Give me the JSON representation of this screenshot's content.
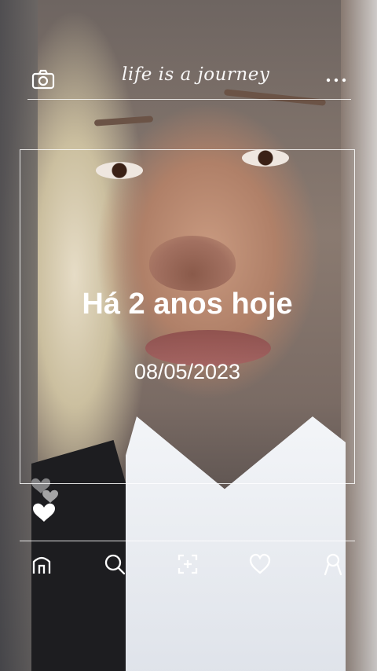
{
  "header": {
    "tagline": "life is a journey",
    "camera_icon": "camera-icon",
    "menu_icon": "more-dots-icon"
  },
  "memory": {
    "title": "Há 2 anos hoje",
    "date": "08/05/2023"
  },
  "reactions": {
    "icon": "hearts-icon"
  },
  "nav": {
    "items": [
      {
        "icon": "home-icon"
      },
      {
        "icon": "search-icon"
      },
      {
        "icon": "add-icon"
      },
      {
        "icon": "heart-icon"
      },
      {
        "icon": "profile-icon"
      }
    ]
  },
  "colors": {
    "overlay": "#ffffff",
    "text": "#ffffff"
  }
}
